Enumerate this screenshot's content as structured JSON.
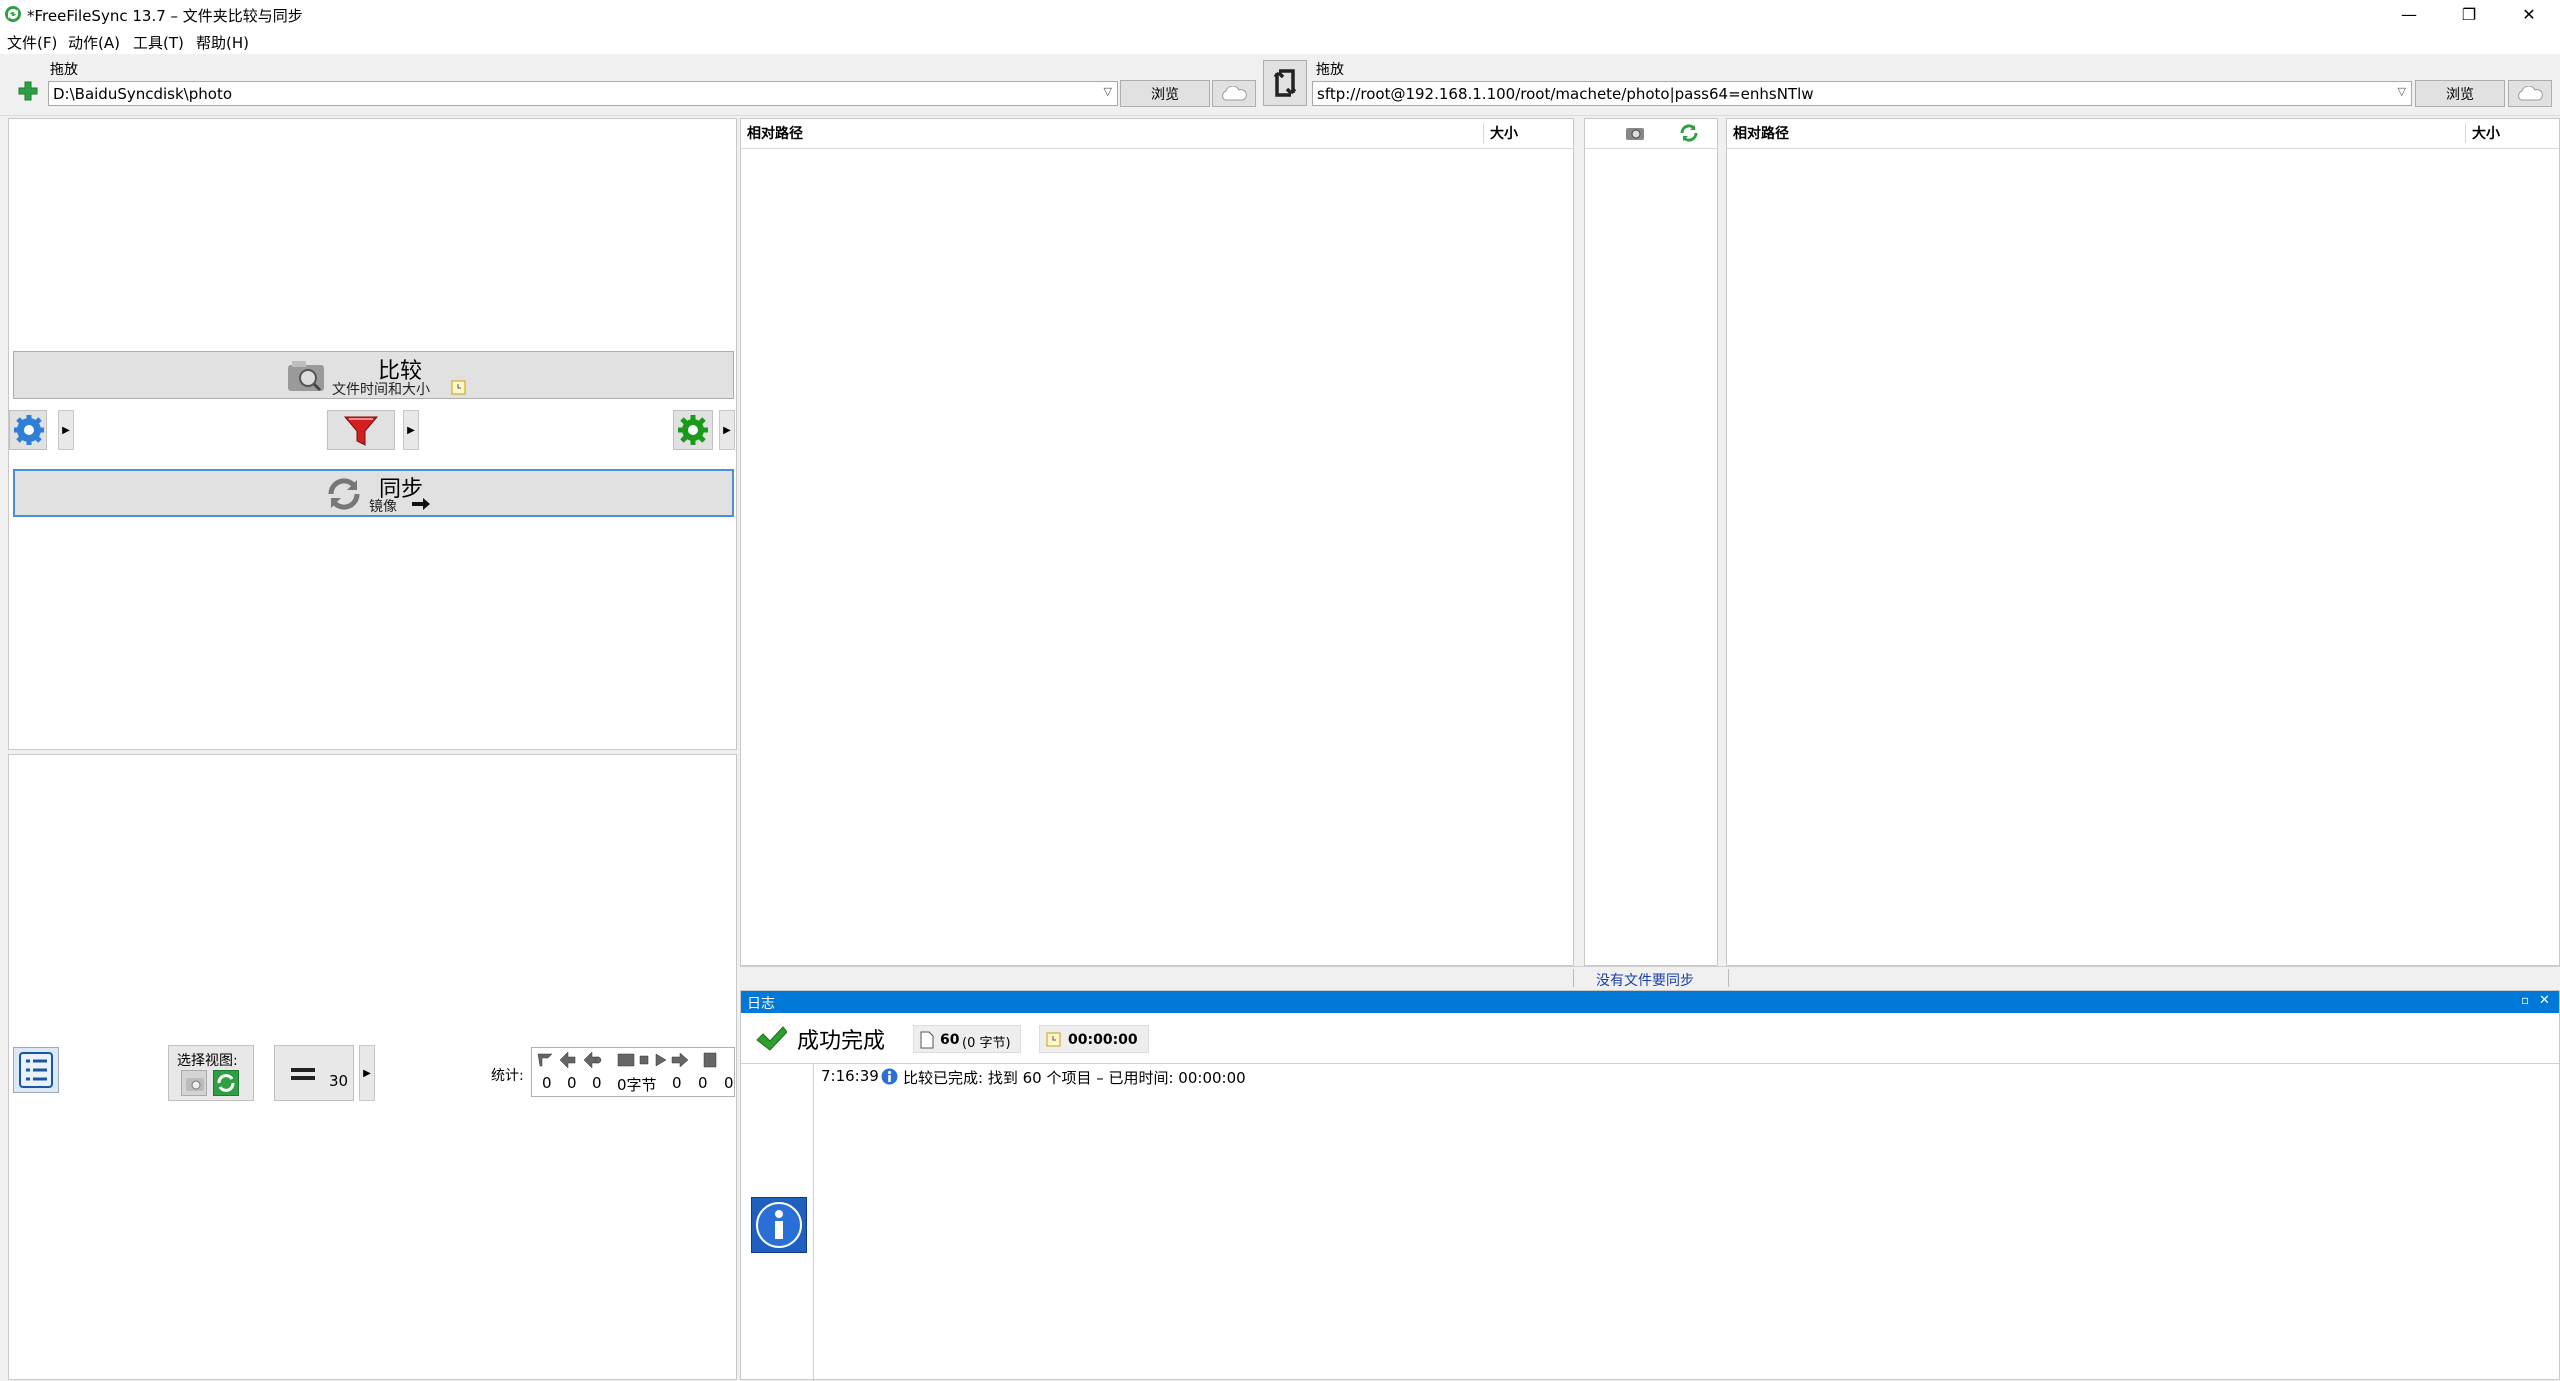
{
  "window": {
    "title": "*FreeFileSync 13.7 – 文件夹比较与同步",
    "minimize_glyph": "—",
    "maximize_glyph": "❐",
    "close_glyph": "✕"
  },
  "menu": [
    "文件(F)",
    "动作(A)",
    "工具(T)",
    "帮助(H)"
  ],
  "left_folder": {
    "label": "拖放",
    "path": "D:\\BaiduSyncdisk\\photo",
    "browse_label": "浏览"
  },
  "right_folder": {
    "label": "拖放",
    "path": "sftp://root@192.168.1.100/root/machete/photo|pass64=enhsNTlw",
    "browse_label": "浏览"
  },
  "compare": {
    "title": "比较",
    "subtitle": "文件时间和大小"
  },
  "sync": {
    "title": "同步",
    "subtitle": "镜像"
  },
  "left_grid": {
    "col_path": "相对路径",
    "col_size": "大小"
  },
  "right_grid": {
    "col_path": "相对路径",
    "col_size": "大小"
  },
  "status_center": "没有文件要同步",
  "view": {
    "label": "选择视图:",
    "count": "30"
  },
  "stats": {
    "label": "统计:",
    "values": [
      "0",
      "0",
      "0",
      "0字节",
      "0",
      "0",
      "0"
    ]
  },
  "log": {
    "header": "日志",
    "result": "成功完成",
    "files_count": "60",
    "files_bytes": "(0 字节)",
    "elapsed": "00:00:00",
    "entry_time": "7:16:39",
    "entry_text": "比较已完成: 找到 60 个项目 – 已用时间: 00:00:00"
  },
  "colors": {
    "accent": "#0078d7",
    "success": "#2e9e2e",
    "filter_red": "#d22020",
    "green_gear": "#1a9a1a",
    "blue_gear": "#2f7fd6"
  }
}
